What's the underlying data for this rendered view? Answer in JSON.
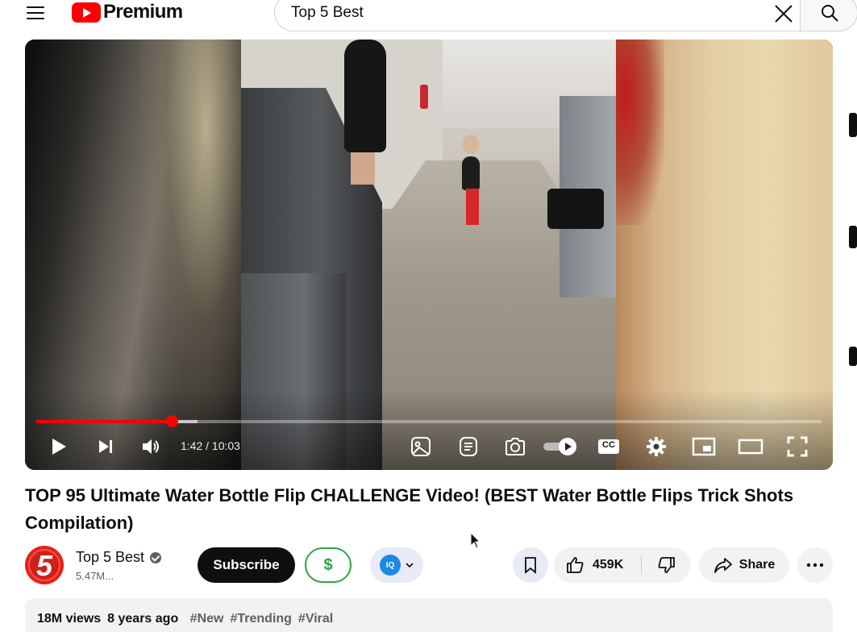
{
  "header": {
    "logo_text": "Premium",
    "search_value": "Top 5 Best",
    "icons": {
      "menu": "hamburger-menu-icon",
      "clear": "close-icon",
      "search": "search-icon"
    }
  },
  "player": {
    "current_time": "1:42",
    "duration": "10:03",
    "time_display": "1:42 / 10:03",
    "played_fraction": 0.1726,
    "buffered_fraction": 0.205,
    "progress_color": "#ff0000",
    "icons": [
      "play-icon",
      "next-icon",
      "volume-icon",
      "image-icon",
      "chapters-icon",
      "camera-icon",
      "autoplay-toggle-icon",
      "captions-icon",
      "settings-icon",
      "miniplayer-icon",
      "theater-icon",
      "fullscreen-icon"
    ],
    "captions_label": "CC"
  },
  "video": {
    "title": "TOP 95 Ultimate Water Bottle Flip CHALLENGE Video! (BEST Water Bottle Flips Trick Shots Compilation)"
  },
  "channel": {
    "avatar_text": "5",
    "name": "Top 5 Best",
    "subscribers": "5.47M...",
    "verified": true
  },
  "actions": {
    "subscribe_label": "Subscribe",
    "thanks_label": "$",
    "extension_label": "IQ",
    "like_count": "459K",
    "share_label": "Share",
    "accent_color": "#2ba640"
  },
  "description": {
    "views": "18M views",
    "age": "8 years ago",
    "hashtags": [
      "#New",
      "#Trending",
      "#Viral"
    ]
  }
}
